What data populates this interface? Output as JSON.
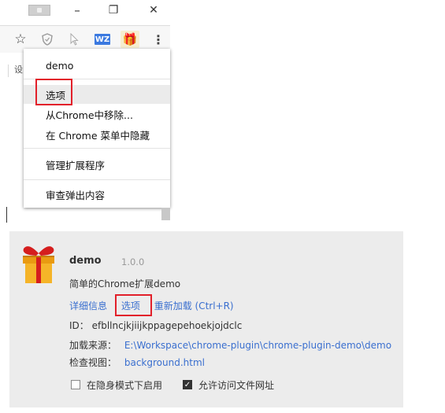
{
  "window": {
    "minimize_glyph": "–",
    "restore_glyph": "❐",
    "close_glyph": "✕"
  },
  "toolbar": {
    "wz_label": "WZ",
    "left_clip_text": "设"
  },
  "menu": {
    "items": [
      {
        "label": "demo"
      },
      {
        "label": "选项"
      },
      {
        "label": "从Chrome中移除..."
      },
      {
        "label": "在 Chrome 菜单中隐藏"
      },
      {
        "label": "管理扩展程序"
      },
      {
        "label": "审查弹出内容"
      }
    ],
    "selected_index": 1
  },
  "extension": {
    "name": "demo",
    "version": "1.0.0",
    "description": "简单的Chrome扩展demo",
    "links": {
      "details": "详细信息",
      "options": "选项",
      "reload": "重新加载 (Ctrl+R)"
    },
    "id_label": "ID：",
    "id_value": "efbllncjkjiijkppagepehoekjojdclc",
    "source_label": "加载来源：",
    "source_value": "E:\\Workspace\\chrome-plugin\\chrome-plugin-demo\\demo",
    "inspect_label": "检查视图：",
    "inspect_value": "background.html",
    "incognito_label": "在隐身模式下启用",
    "incognito_checked": false,
    "file_access_label": "允许访问文件网址",
    "file_access_checked": true
  },
  "colors": {
    "highlight": "#e2202a",
    "link": "#3a6fcf",
    "card_bg": "#ececec"
  }
}
